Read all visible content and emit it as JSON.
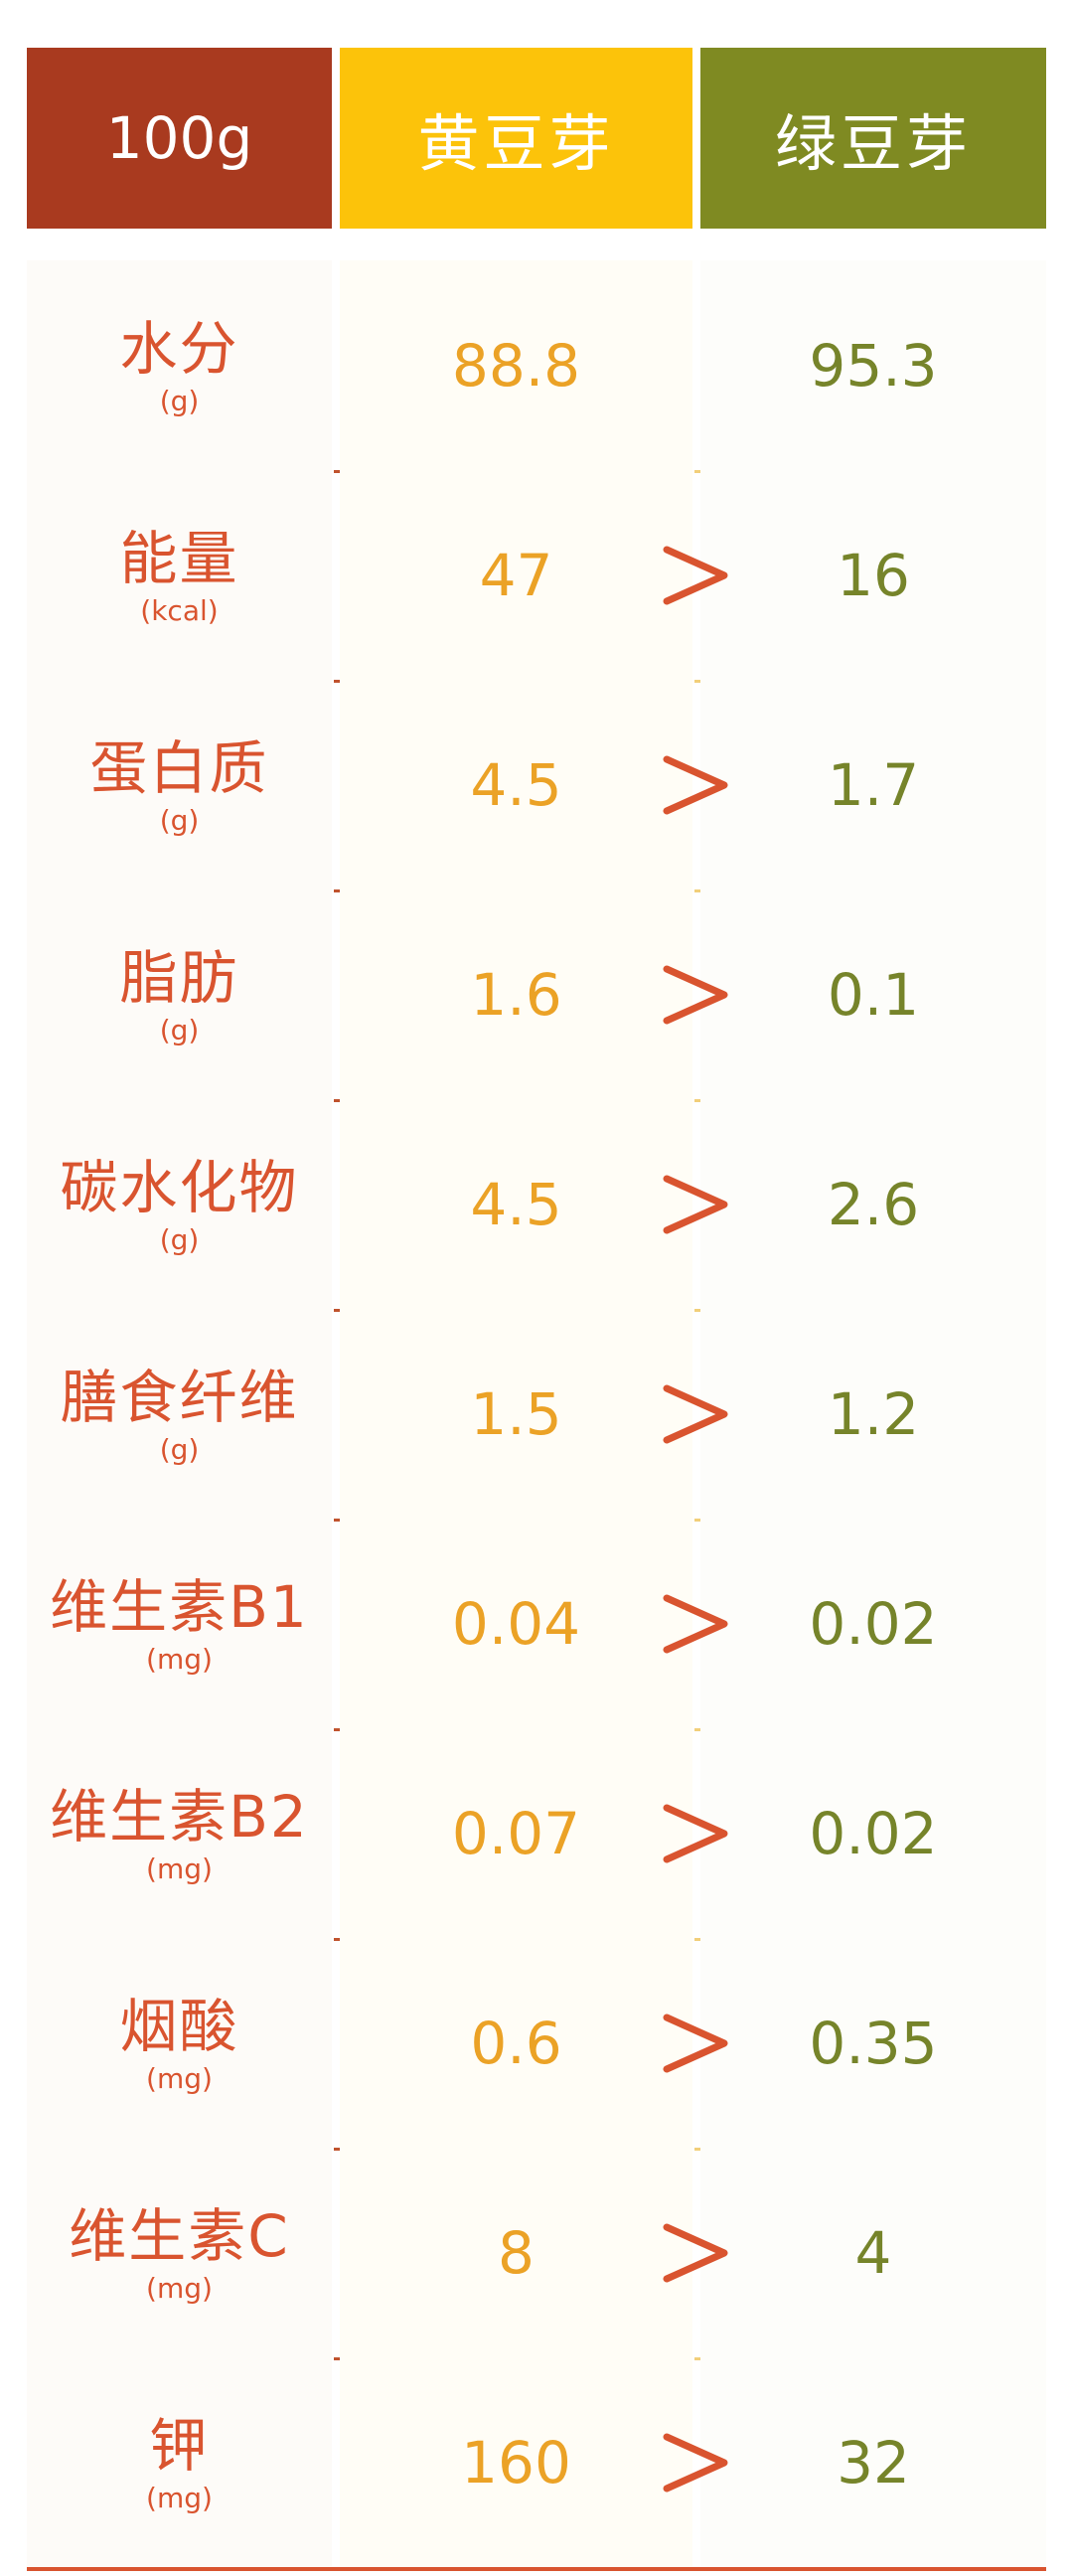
{
  "header": {
    "basis": "100g",
    "soybean_sprouts": "黄豆芽",
    "mung_bean_sprouts": "绿豆芽"
  },
  "comparison_symbol": ">",
  "rows": [
    {
      "name": "水分",
      "unit": "(g)",
      "soybean": "88.8",
      "mung": "95.3",
      "compare": ""
    },
    {
      "name": "能量",
      "unit": "(kcal)",
      "soybean": "47",
      "mung": "16",
      "compare": ">"
    },
    {
      "name": "蛋白质",
      "unit": "(g)",
      "soybean": "4.5",
      "mung": "1.7",
      "compare": ">"
    },
    {
      "name": "脂肪",
      "unit": "(g)",
      "soybean": "1.6",
      "mung": "0.1",
      "compare": ">"
    },
    {
      "name": "碳水化物",
      "unit": "(g)",
      "soybean": "4.5",
      "mung": "2.6",
      "compare": ">"
    },
    {
      "name": "膳食纤维",
      "unit": "(g)",
      "soybean": "1.5",
      "mung": "1.2",
      "compare": ">"
    },
    {
      "name": "维生素B1",
      "unit": "(mg)",
      "soybean": "0.04",
      "mung": "0.02",
      "compare": ">"
    },
    {
      "name": "维生素B2",
      "unit": "(mg)",
      "soybean": "0.07",
      "mung": "0.02",
      "compare": ">"
    },
    {
      "name": "烟酸",
      "unit": "(mg)",
      "soybean": "0.6",
      "mung": "0.35",
      "compare": ">"
    },
    {
      "name": "维生素C",
      "unit": "(mg)",
      "soybean": "8",
      "mung": "4",
      "compare": ">"
    },
    {
      "name": "钾",
      "unit": "(mg)",
      "soybean": "160",
      "mung": "32",
      "compare": ">"
    }
  ],
  "colors": {
    "header_basis_bg": "#a93a1f",
    "header_soybean_bg": "#fcc30a",
    "header_mung_bg": "#7f8a22",
    "label_text": "#d9542f",
    "soybean_value": "#eba226",
    "mung_value": "#76842a",
    "compare_symbol": "#d9542f"
  }
}
